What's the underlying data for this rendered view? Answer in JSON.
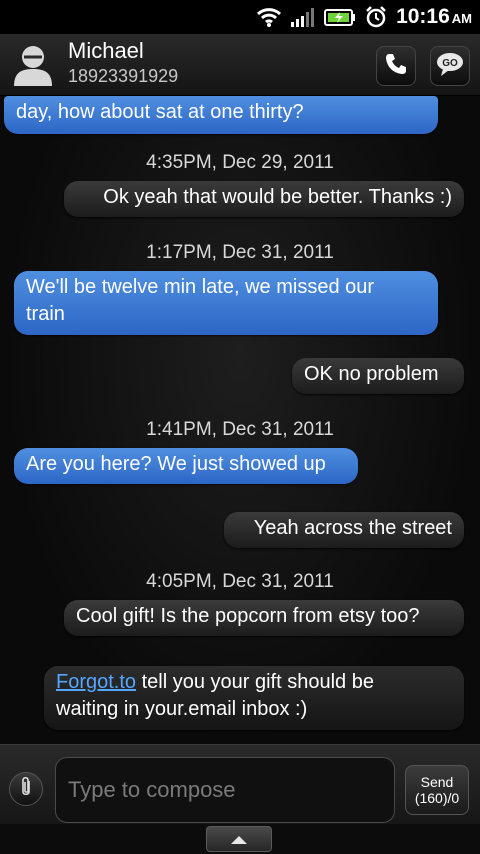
{
  "status_bar": {
    "time": "10:16",
    "ampm": "AM",
    "icons": [
      "wifi-icon",
      "signal-icon",
      "battery-charging-icon",
      "alarm-icon"
    ]
  },
  "header": {
    "contact_name": "Michael",
    "contact_number": "18923391929",
    "avatar_icon": "contact-avatar-icon",
    "call_icon": "phone-icon",
    "go_icon": "go-icon",
    "go_label": "GO"
  },
  "messages": [
    {
      "direction": "incoming",
      "text": "day, how about sat at one thirty?"
    },
    {
      "timestamp": "4:35PM, Dec 29, 2011"
    },
    {
      "direction": "outgoing",
      "text": "Ok yeah that would be better. Thanks :)"
    },
    {
      "timestamp": "1:17PM, Dec 31, 2011"
    },
    {
      "direction": "incoming",
      "line1": "We'll be twelve min late, we missed our",
      "line2": "train"
    },
    {
      "direction": "outgoing",
      "text": "OK no problem"
    },
    {
      "timestamp": "1:41PM, Dec 31, 2011"
    },
    {
      "direction": "incoming",
      "text": "Are you here? We just showed up"
    },
    {
      "direction": "outgoing",
      "text": "Yeah across the street"
    },
    {
      "timestamp": "4:05PM, Dec 31, 2011"
    },
    {
      "direction": "outgoing",
      "text": "Cool gift! Is the popcorn from etsy too?"
    },
    {
      "direction": "outgoing",
      "link": "Forgot.to",
      "rest1": " tell you your gift should be",
      "line2": "waiting in your.email inbox :)"
    }
  ],
  "compose": {
    "placeholder": "Type to compose",
    "value": "",
    "attach_icon": "paperclip-icon",
    "send_label": "Send",
    "char_count": "(160)/0"
  },
  "bottom": {
    "handle_icon": "chevron-up-icon"
  },
  "colors": {
    "incoming_bubble": "#3a78d6",
    "outgoing_bubble": "#2a2a2a",
    "link": "#55a6ff",
    "battery": "#6fd33a"
  }
}
